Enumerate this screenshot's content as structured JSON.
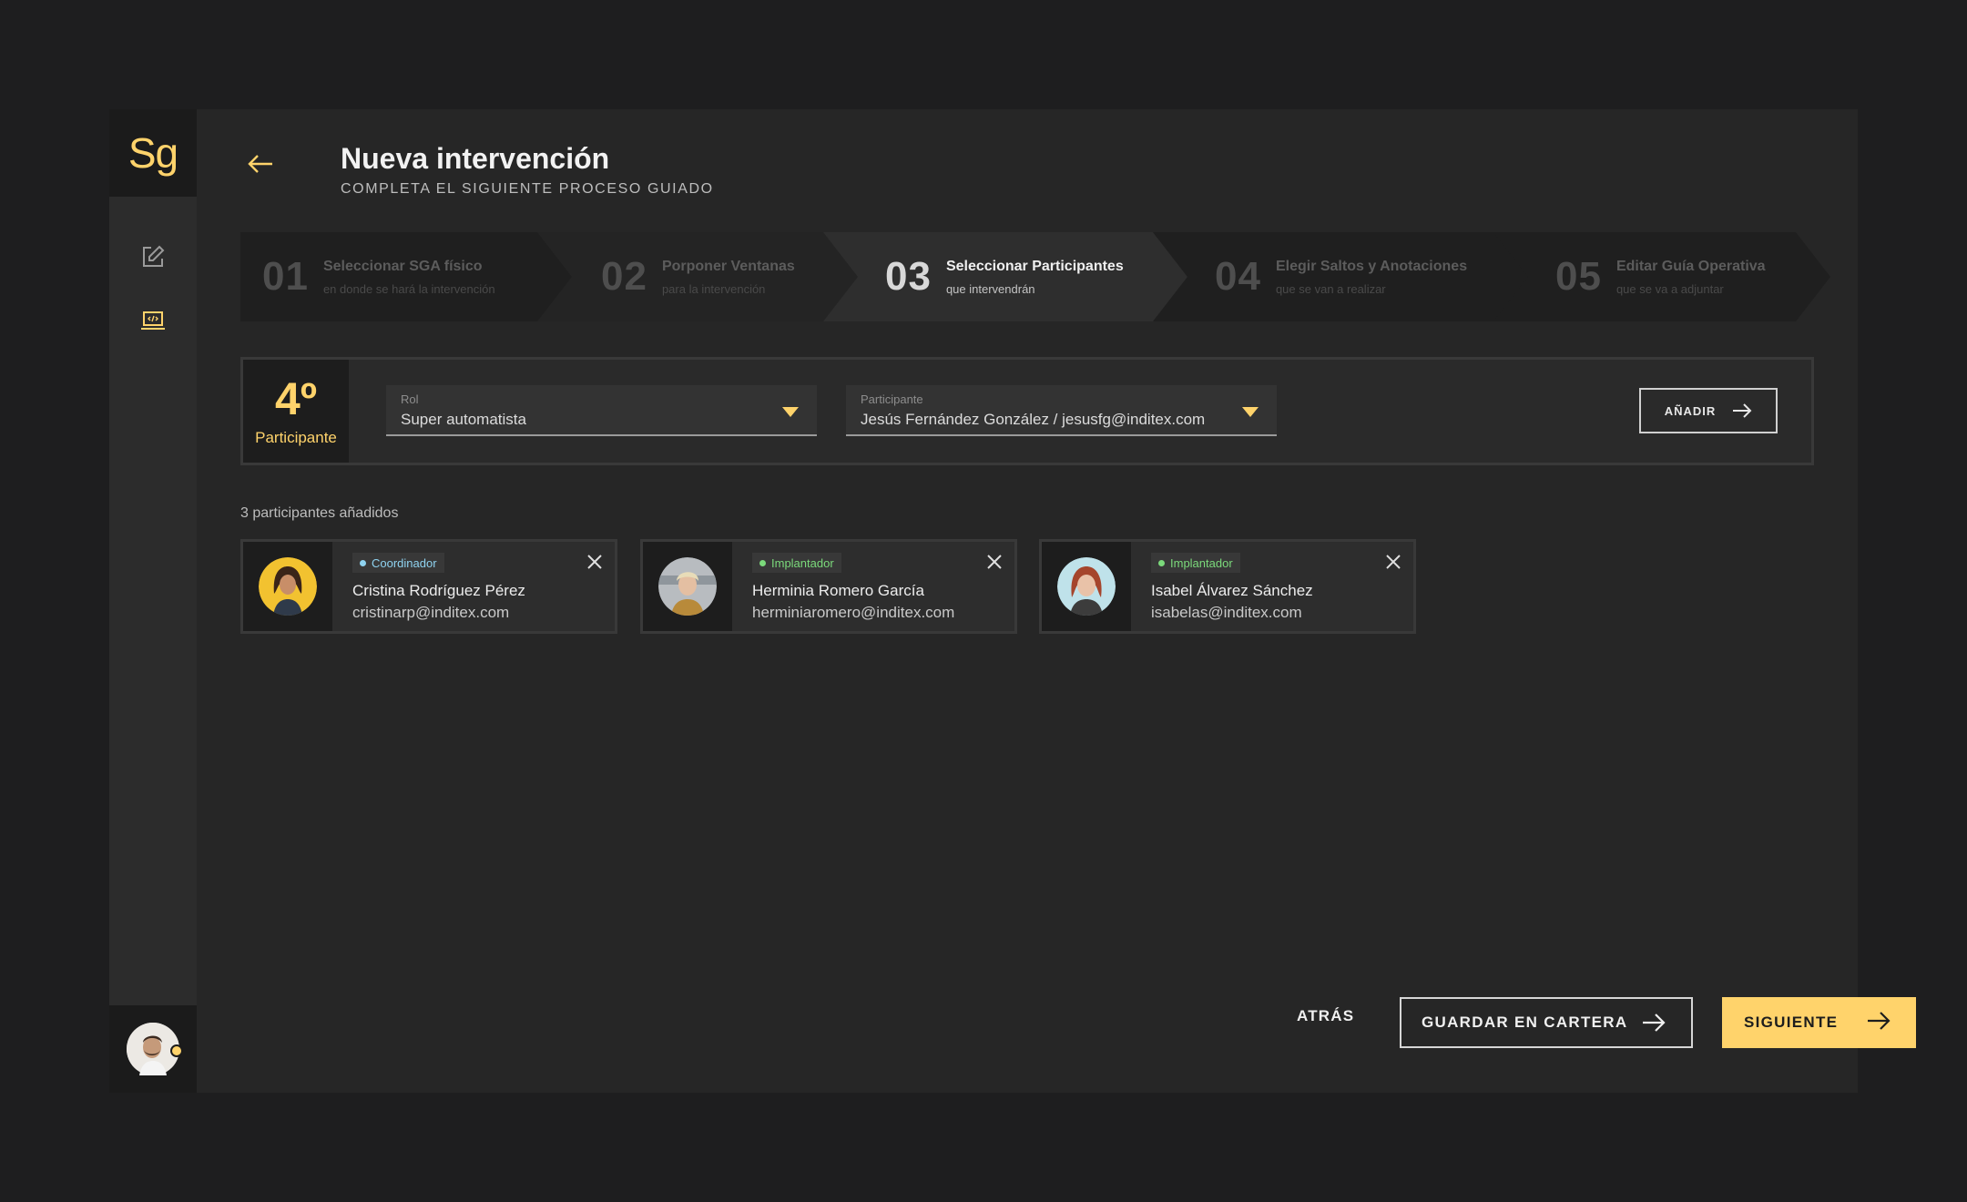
{
  "logo": "Sg",
  "header": {
    "title": "Nueva intervención",
    "subtitle": "COMPLETA EL SIGUIENTE PROCESO GUIADO"
  },
  "steps": [
    {
      "num": "01",
      "title": "Seleccionar SGA físico",
      "desc": "en donde se hará la intervención",
      "active": false
    },
    {
      "num": "02",
      "title": "Porponer Ventanas",
      "desc": "para la intervención",
      "active": false
    },
    {
      "num": "03",
      "title": "Seleccionar Participantes",
      "desc": "que intervendrán",
      "active": true
    },
    {
      "num": "04",
      "title": "Elegir Saltos y Anotaciones",
      "desc": "que se van a realizar",
      "active": false
    },
    {
      "num": "05",
      "title": "Editar Guía Operativa",
      "desc": "que se va a adjuntar",
      "active": false
    }
  ],
  "form": {
    "count_num": "4º",
    "count_label": "Participante",
    "role": {
      "label": "Rol",
      "value": "Super automatista"
    },
    "participant": {
      "label": "Participante",
      "value": "Jesús Fernández González / jesusfg@inditex.com"
    },
    "add_label": "AÑADIR"
  },
  "participants_added": "3 participantes añadidos",
  "participants": [
    {
      "role": "Coordinador",
      "role_color": "#8fd3f0",
      "name": "Cristina Rodríguez Pérez",
      "email": "cristinarp@inditex.com"
    },
    {
      "role": "Implantador",
      "role_color": "#7bd97b",
      "name": "Herminia Romero García",
      "email": "herminiaromero@inditex.com"
    },
    {
      "role": "Implantador",
      "role_color": "#7bd97b",
      "name": "Isabel Álvarez Sánchez",
      "email": "isabelas@inditex.com"
    }
  ],
  "footer": {
    "back_label": "ATRÁS",
    "save_label": "GUARDAR EN CARTERA",
    "next_label": "SIGUIENTE"
  },
  "colors": {
    "accent": "#ffd36b"
  }
}
